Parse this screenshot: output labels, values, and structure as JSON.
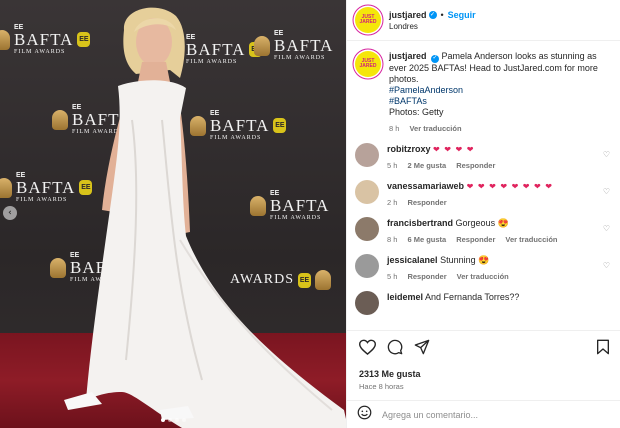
{
  "post": {
    "username": "justjared",
    "follow_label": "Seguir",
    "separator": "•",
    "location": "Londres",
    "avatar_text": "JUST JARED"
  },
  "backdrop": {
    "brand": "BAFTA",
    "ee": "EE",
    "sub": "FILM AWARDS"
  },
  "caption": {
    "username": "justjared",
    "text": "Pamela Anderson looks as stunning as ever 2025 BAFTAs! Head to JustJared.com for more photos.",
    "hashtag1": "#PamelaAnderson",
    "hashtag2": "#BAFTAs",
    "credit": "Photos: Getty",
    "time": "8 h",
    "translate": "Ver traducción"
  },
  "comments": [
    {
      "user": "robitzroxy",
      "text": "❤ ❤ ❤ ❤",
      "time": "5 h",
      "likes": "2 Me gusta",
      "reply": "Responder",
      "avatar_color": "#b7a29a"
    },
    {
      "user": "vanessamariaweb",
      "text": "❤ ❤ ❤ ❤ ❤ ❤ ❤ ❤",
      "time": "2 h",
      "likes": "",
      "reply": "Responder",
      "avatar_color": "#d9c3a4"
    },
    {
      "user": "francisbertrand",
      "text": "Gorgeous 😍",
      "time": "8 h",
      "likes": "6 Me gusta",
      "reply": "Responder",
      "translate": "Ver traducción",
      "avatar_color": "#8c7a6a"
    },
    {
      "user": "jessicalanel",
      "text": "Stunning 😍",
      "time": "5 h",
      "likes": "",
      "reply": "Responder",
      "translate": "Ver traducción",
      "avatar_color": "#9a9a9a"
    },
    {
      "user": "leidemel",
      "text": "And Fernanda Torres??",
      "avatar_color": "#6b5d55"
    }
  ],
  "footer": {
    "likes": "2313 Me gusta",
    "ago": "Hace 8 horas",
    "add_comment_placeholder": "Agrega un comentario..."
  },
  "icons": {
    "like": "heart-icon",
    "comment": "comment-icon",
    "share": "share-icon",
    "save": "bookmark-icon",
    "emoji": "emoji-icon",
    "prev": "chevron-left-icon"
  },
  "colors": {
    "accent": "#0095f6",
    "hashtag": "#00376b",
    "heart_red": "#e0245e",
    "avatar_yellow": "#f5e60a",
    "carpet": "#8e1c27"
  }
}
